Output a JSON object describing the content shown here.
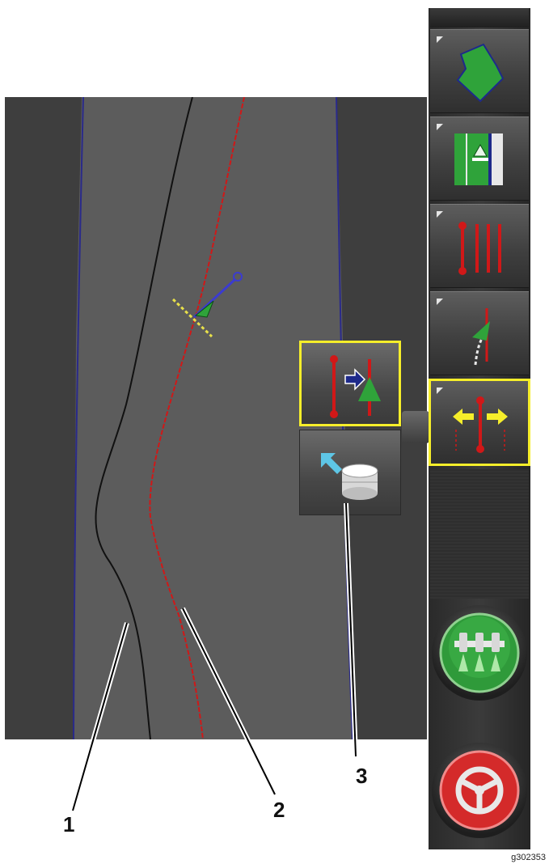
{
  "callouts": [
    {
      "label": "1"
    },
    {
      "label": "2"
    },
    {
      "label": "3"
    }
  ],
  "figure_code": "g302353",
  "toolbar": {
    "buttons": [
      {
        "icon": "field-boundary-icon"
      },
      {
        "icon": "guidance-pattern-icon"
      },
      {
        "icon": "guidelines-icon"
      },
      {
        "icon": "steering-icon"
      },
      {
        "icon": "nudge-guideline-icon",
        "selected": true
      }
    ],
    "section_control_icon": "sprayer-sections-icon",
    "autosteer_icon": "steering-wheel-icon"
  },
  "popup": {
    "buttons": [
      {
        "icon": "shift-guideline-to-vehicle-icon",
        "selected": true
      },
      {
        "icon": "save-guideline-icon",
        "selected": false
      }
    ]
  },
  "colors": {
    "map_background": "#3e3e3e",
    "field_area": "#5c5c5c",
    "original_line": "#111111",
    "shifted_line": "#d01818",
    "boundary": "#2a2a8a",
    "highlight": "#f6ee2a"
  }
}
